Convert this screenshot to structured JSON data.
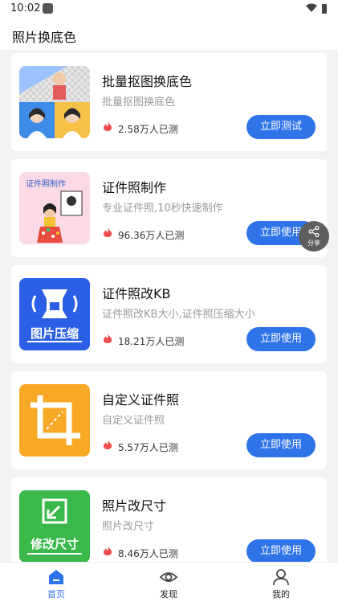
{
  "status_bar": {
    "time": "10:02"
  },
  "app_bar": {
    "title": "照片换底色"
  },
  "cards": [
    {
      "title": "批量抠图换底色",
      "desc": "批量抠图换底色",
      "count": "2.58万人已测",
      "button": "立即测试",
      "thumb": "photo-collage"
    },
    {
      "title": "证件照制作",
      "desc": "专业证件照,10秒快速制作",
      "count": "96.36万人已测",
      "button": "立即使用",
      "thumb_text": "证件照制作"
    },
    {
      "title": "证件照改KB",
      "desc": "证件照改KB大小,证件照压缩大小",
      "count": "18.21万人已测",
      "button": "立即使用",
      "thumb_text": "图片压缩",
      "thumb_color": "#2b5fe6"
    },
    {
      "title": "自定义证件照",
      "desc": "自定义证件照",
      "count": "5.57万人已测",
      "button": "立即使用",
      "thumb_color": "#f7a824"
    },
    {
      "title": "照片改尺寸",
      "desc": "照片改尺寸",
      "count": "8.46万人已测",
      "button": "立即使用",
      "thumb_text": "修改尺寸",
      "thumb_color": "#3ab84a"
    }
  ],
  "share": {
    "label": "分享"
  },
  "bottom_nav": [
    {
      "label": "首页",
      "icon": "home-icon",
      "active": true
    },
    {
      "label": "发现",
      "icon": "eye-icon",
      "active": false
    },
    {
      "label": "我的",
      "icon": "user-icon",
      "active": false
    }
  ],
  "colors": {
    "accent": "#2f73e8",
    "fire": "#f24d4d",
    "background": "#f3f3f3"
  }
}
